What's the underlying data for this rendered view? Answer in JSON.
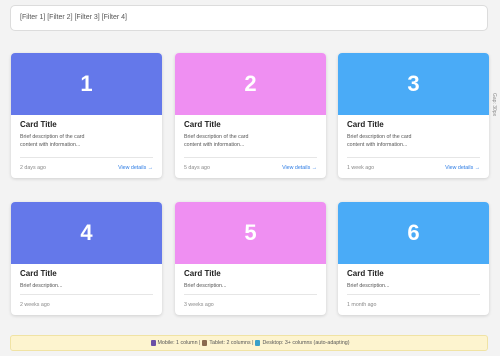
{
  "filter_bar": {
    "text": "[Filter 1] [Filter 2] [Filter 3] [Filter 4]"
  },
  "gap_label": "Gap: 30px",
  "cards": [
    {
      "number": "1",
      "title": "Card Title",
      "description": "Brief description of the card content with information...",
      "time": "2 days ago",
      "link": "View details →",
      "color": "#6478ea"
    },
    {
      "number": "2",
      "title": "Card Title",
      "description": "Brief description of the card content with information...",
      "time": "5 days ago",
      "link": "View details →",
      "color": "#ef8ff2"
    },
    {
      "number": "3",
      "title": "Card Title",
      "description": "Brief description of the card content with information...",
      "time": "1 week ago",
      "link": "View details →",
      "color": "#4aabf7"
    },
    {
      "number": "4",
      "title": "Card Title",
      "description": "Brief description...",
      "time": "2 weeks ago",
      "color": "#6478ea"
    },
    {
      "number": "5",
      "title": "Card Title",
      "description": "Brief description...",
      "time": "3 weeks ago",
      "color": "#ef8ff2"
    },
    {
      "number": "6",
      "title": "Card Title",
      "description": "Brief description...",
      "time": "1 month ago",
      "color": "#4aabf7"
    }
  ],
  "info_bar": {
    "mobile": "Mobile: 1 column |",
    "tablet": "Tablet: 2 columns |",
    "desktop": "Desktop: 3+ columns (auto-adapting)",
    "icons": [
      "mobile-phone-icon",
      "tablet-icon",
      "desktop-monitor-icon"
    ]
  }
}
